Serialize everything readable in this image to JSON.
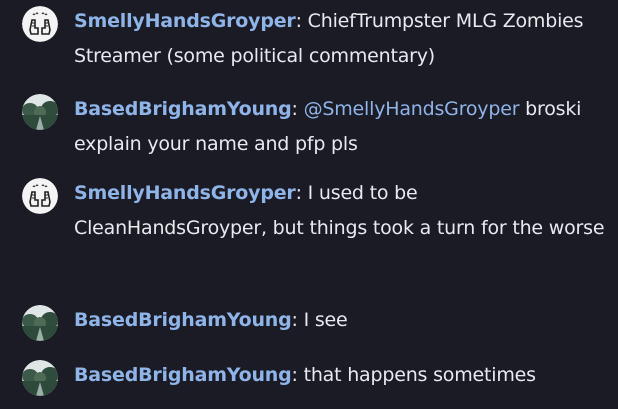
{
  "messages": [
    {
      "author": "SmellyHandsGroyper",
      "avatar": "praying-hands-icon",
      "separator": ":",
      "text": "ChiefTrumpster MLG Zombies Streamer (some political commentary)"
    },
    {
      "author": "BasedBrighamYoung",
      "avatar": "landscape-avatar-icon",
      "separator": ":",
      "mention": "@SmellyHandsGroyper",
      "text": "broski explain your  name and pfp pls"
    },
    {
      "author": "SmellyHandsGroyper",
      "avatar": "praying-hands-icon",
      "separator": ":",
      "text": "I used to be CleanHandsGroyper, but things took a turn for the worse"
    },
    {
      "author": "BasedBrighamYoung",
      "avatar": "landscape-avatar-icon",
      "separator": ":",
      "text": "I see"
    },
    {
      "author": "BasedBrighamYoung",
      "avatar": "landscape-avatar-icon",
      "separator": ":",
      "text": "that happens sometimes"
    }
  ],
  "colors": {
    "background": "#1b1b26",
    "username": "#8fb4e8",
    "text": "#e9e9ee"
  }
}
